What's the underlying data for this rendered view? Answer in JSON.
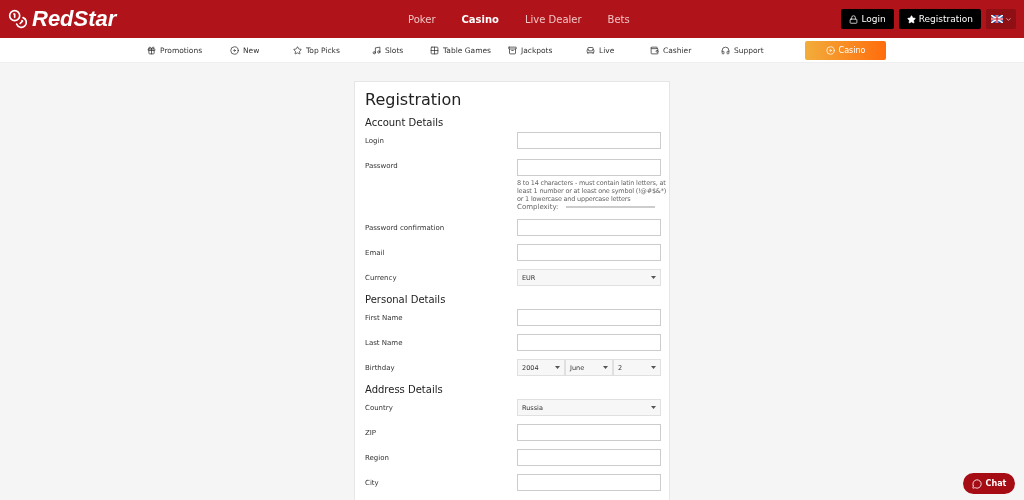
{
  "header": {
    "logo": "RedStar",
    "nav": [
      {
        "label": "Poker",
        "selected": false
      },
      {
        "label": "Casino",
        "selected": true
      },
      {
        "label": "Live Dealer",
        "selected": false
      },
      {
        "label": "Bets",
        "selected": false
      }
    ],
    "login_button": "Login",
    "registration_button": "Registration"
  },
  "subnav": {
    "items": [
      "Promotions",
      "New",
      "Top Picks",
      "Slots",
      "Table Games",
      "Jackpots",
      "Live",
      "Cashier",
      "Support"
    ],
    "casino_button": "Casino"
  },
  "form": {
    "title": "Registration",
    "sections": [
      {
        "heading": "Account Details",
        "fields": [
          {
            "kind": "text",
            "label": "Login"
          },
          {
            "kind": "password",
            "label": "Password",
            "hint": "8 to 14 characters - must contain latin letters, at least 1 number or at least one symbol (!@#$&*) or 1 lowercase and uppercase letters",
            "complexity_label": "Complexity:",
            "level": 0
          },
          {
            "kind": "text",
            "label": "Password confirmation"
          },
          {
            "kind": "text",
            "label": "Email"
          },
          {
            "kind": "select",
            "label": "Currency",
            "value": "EUR"
          }
        ]
      },
      {
        "heading": "Personal Details",
        "fields": [
          {
            "kind": "text",
            "label": "First Name"
          },
          {
            "kind": "text",
            "label": "Last Name"
          },
          {
            "kind": "date",
            "label": "Birthday",
            "values": [
              "2004",
              "June",
              "2"
            ]
          }
        ]
      },
      {
        "heading": "Address Details",
        "fields": [
          {
            "kind": "select",
            "label": "Country",
            "value": "Russia"
          },
          {
            "kind": "text",
            "label": "ZIP"
          },
          {
            "kind": "text",
            "label": "Region"
          },
          {
            "kind": "text",
            "label": "City"
          }
        ]
      }
    ]
  },
  "chat_button": "Chat"
}
